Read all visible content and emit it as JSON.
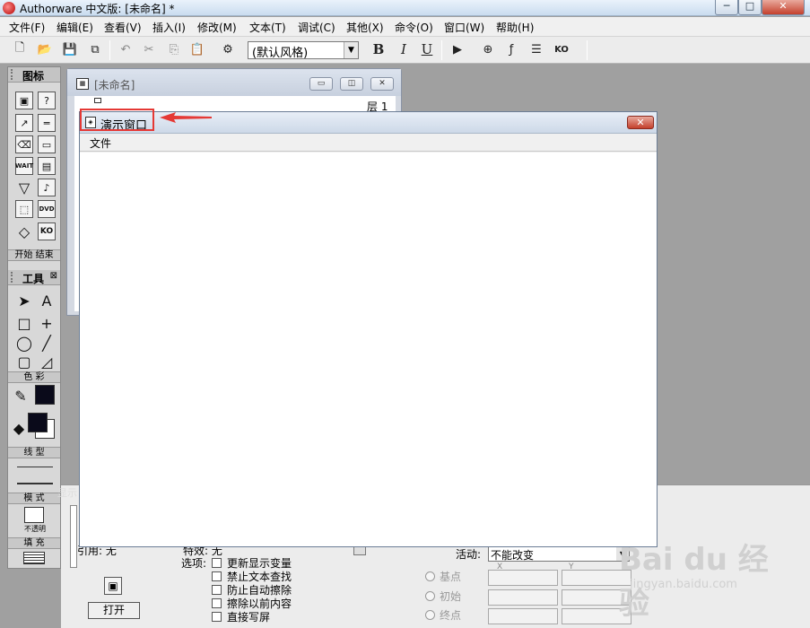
{
  "app": {
    "title": "Authorware 中文版: [未命名] *",
    "controls": {
      "minimize": "─",
      "maximize": "□",
      "close": "✕"
    }
  },
  "menu": [
    "文件(F)",
    "编辑(E)",
    "查看(V)",
    "插入(I)",
    "修改(M)",
    "文本(T)",
    "调试(C)",
    "其他(X)",
    "命令(O)",
    "窗口(W)",
    "帮助(H)"
  ],
  "toolbar": {
    "style_combo": "(默认风格)",
    "bold": "B",
    "italic": "I",
    "underline": "U",
    "icons": [
      "new-icon",
      "open-icon",
      "save-all-icon",
      "import-icon",
      "undo-icon",
      "cut-icon",
      "copy-icon",
      "paste-icon",
      "find-icon"
    ]
  },
  "icon_palette": {
    "title": "图标",
    "start_end": "开始 结束",
    "items": [
      "display-icon",
      "question-icon",
      "motion-icon",
      "erase-icon",
      "wait-icon",
      "navigate-icon",
      "framework-icon",
      "decision-icon",
      "interaction-icon",
      "calc-icon",
      "map-icon",
      "movie-icon",
      "sound-icon",
      "dvd-icon",
      "knowledge-object-icon"
    ],
    "wait_label": "WAIT",
    "dvd_label": "DVD",
    "ko_label": "KO"
  },
  "tools_palette": {
    "title": "工具",
    "color_label": "色 彩",
    "line_label": "线 型",
    "mode_label": "模 式",
    "mode_value": "不透明",
    "fill_label": "填 充"
  },
  "flowline_window": {
    "title": "[未命名]",
    "layer_label": "层 1"
  },
  "presentation_window": {
    "title": "演示窗口",
    "menu_file": "文件"
  },
  "properties": {
    "open_button": "打开",
    "ref_label": "引用: 无",
    "effect_label": "特效: 无",
    "options_label": "选项:",
    "checkboxes": [
      "更新显示变量",
      "禁止文本查找",
      "防止自动擦除",
      "擦除以前内容",
      "直接写屏"
    ],
    "activity_label": "活动:",
    "activity_value": "不能改变",
    "col_x": "X",
    "col_y": "Y",
    "radio_base": "基点",
    "radio_initial": "初始",
    "radio_end": "终点",
    "side_label": "显示"
  },
  "watermark": {
    "brand": "Bai du 经验",
    "url": "jingyan.baidu.com"
  },
  "annotation_color": "#e53935"
}
